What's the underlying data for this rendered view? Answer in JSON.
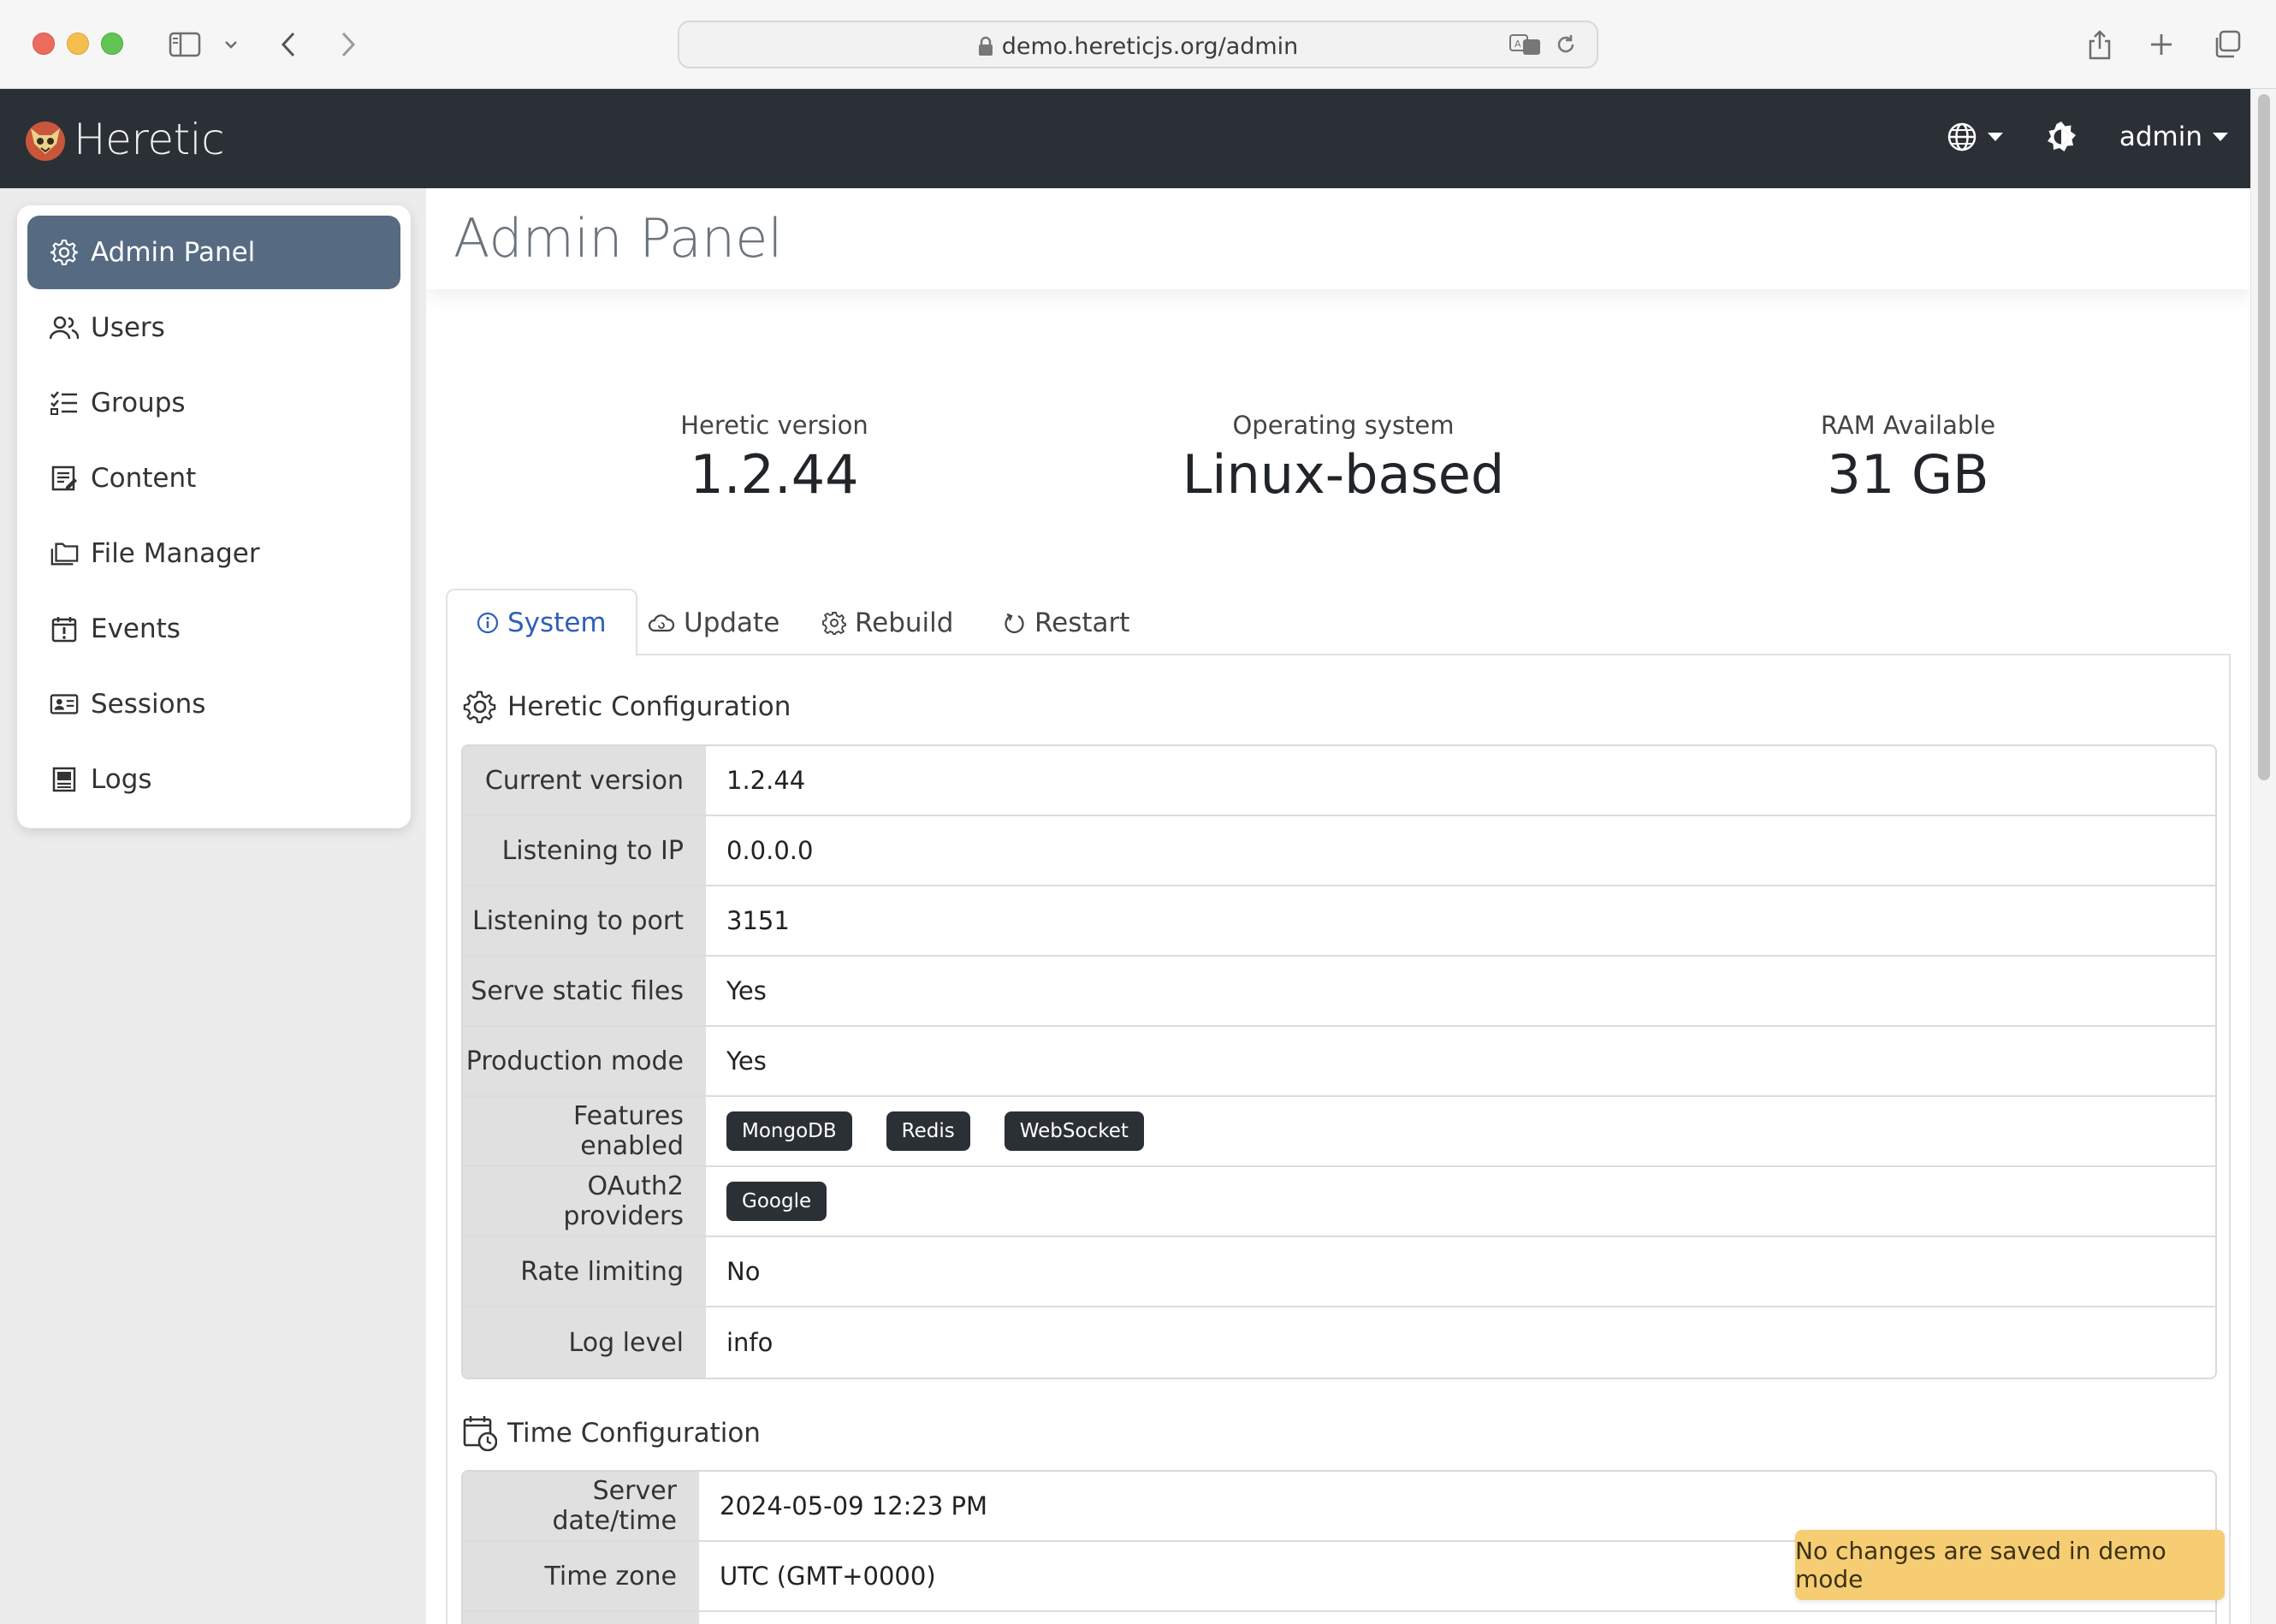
{
  "browser": {
    "url": "demo.hereticjs.org/admin"
  },
  "navbar": {
    "brand": "Heretic",
    "user_label": "admin"
  },
  "sidebar": {
    "items": [
      {
        "label": "Admin Panel",
        "icon": "gear-icon",
        "active": true
      },
      {
        "label": "Users",
        "icon": "users-icon"
      },
      {
        "label": "Groups",
        "icon": "list-check-icon"
      },
      {
        "label": "Content",
        "icon": "document-icon"
      },
      {
        "label": "File Manager",
        "icon": "folders-icon"
      },
      {
        "label": "Events",
        "icon": "calendar-alert-icon"
      },
      {
        "label": "Sessions",
        "icon": "id-card-icon"
      },
      {
        "label": "Logs",
        "icon": "log-icon"
      }
    ]
  },
  "page": {
    "title": "Admin Panel"
  },
  "stats": [
    {
      "label": "Heretic version",
      "value": "1.2.44"
    },
    {
      "label": "Operating system",
      "value": "Linux-based"
    },
    {
      "label": "RAM Available",
      "value": "31 GB"
    }
  ],
  "tabs": [
    {
      "label": "System",
      "icon": "info-icon",
      "active": true
    },
    {
      "label": "Update",
      "icon": "cloud-icon"
    },
    {
      "label": "Rebuild",
      "icon": "gears-icon"
    },
    {
      "label": "Restart",
      "icon": "restart-icon"
    }
  ],
  "heretic_config": {
    "title": "Heretic Configuration",
    "rows": [
      {
        "key": "Current version",
        "value": "1.2.44"
      },
      {
        "key": "Listening to IP",
        "value": "0.0.0.0"
      },
      {
        "key": "Listening to port",
        "value": "3151"
      },
      {
        "key": "Serve static files",
        "value": "Yes"
      },
      {
        "key": "Production mode",
        "value": "Yes"
      },
      {
        "key": "Features enabled",
        "pills": [
          "MongoDB",
          "Redis",
          "WebSocket"
        ]
      },
      {
        "key": "OAuth2 providers",
        "pills": [
          "Google"
        ]
      },
      {
        "key": "Rate limiting",
        "value": "No"
      },
      {
        "key": "Log level",
        "value": "info"
      }
    ]
  },
  "time_config": {
    "title": "Time Configuration",
    "rows": [
      {
        "key": "Server date/time",
        "value": "2024-05-09 12:23 PM"
      },
      {
        "key": "Time zone",
        "value": "UTC (GMT+0000)"
      }
    ]
  },
  "toast": {
    "message": "No changes are saved in demo mode"
  },
  "colors": {
    "navbar_bg": "#2b3036",
    "sidebar_active": "#566a82",
    "tab_active_text": "#2f5fb8",
    "toast_bg": "#f6cd73",
    "pill_bg": "#2b3036"
  }
}
